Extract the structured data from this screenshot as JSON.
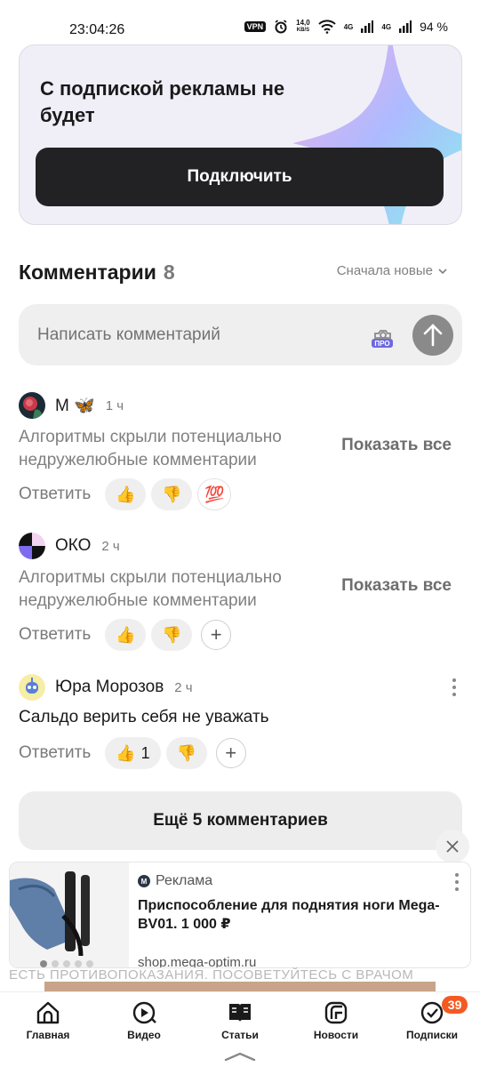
{
  "status_bar": {
    "time": "23:04:26",
    "vpn": "VPN",
    "speed_value": "14,0",
    "speed_unit": "KB/S",
    "net1": "4G",
    "net2": "4G",
    "battery": "94 %"
  },
  "promo": {
    "title": "С подпиской рекламы не будет",
    "button": "Подключить"
  },
  "comments": {
    "heading": "Комментарии",
    "count": "8",
    "sort": "Сначала новые",
    "input_placeholder": "Написать комментарий",
    "pro_badge": "ПРО",
    "items": [
      {
        "name": "М 🦋",
        "time": "1 ч",
        "hidden_text": "Алгоритмы скрыли потенциально недружелюбные комментарии",
        "show_all": "Показать все",
        "reply": "Ответить",
        "reactions": [
          "👍",
          "👎",
          "💯"
        ]
      },
      {
        "name": "ОКО",
        "time": "2 ч",
        "hidden_text": "Алгоритмы скрыли потенциально недружелюбные комментарии",
        "show_all": "Показать все",
        "reply": "Ответить",
        "reactions": [
          "👍",
          "👎"
        ],
        "plus": "+"
      },
      {
        "name": "Юра Морозов",
        "time": "2 ч",
        "text": "Сальдо верить себя не уважать",
        "reply": "Ответить",
        "reactions": [
          "👍",
          "👎"
        ],
        "like_count": "1",
        "plus": "+"
      }
    ],
    "more_button": "Ещё 5 комментариев"
  },
  "ad": {
    "logo_letter": "M",
    "label": "Реклама",
    "title": "Приспособление для поднятия ноги Mega-BV01. 1 000 ₽",
    "url": "shop.mega-optim.ru",
    "disclaimer": "ЕСТЬ ПРОТИВОПОКАЗАНИЯ. ПОСОВЕТУЙТЕСЬ С ВРАЧОМ"
  },
  "bottom_nav": {
    "items": [
      {
        "label": "Главная",
        "icon": "home-icon"
      },
      {
        "label": "Видео",
        "icon": "video-icon"
      },
      {
        "label": "Статьи",
        "icon": "articles-icon"
      },
      {
        "label": "Новости",
        "icon": "news-icon"
      },
      {
        "label": "Подписки",
        "icon": "subscriptions-icon"
      }
    ],
    "subscriptions_badge": "39"
  },
  "colors": {
    "accent_badge": "#f35a22",
    "button_dark": "#222224",
    "muted_text": "#808080"
  }
}
